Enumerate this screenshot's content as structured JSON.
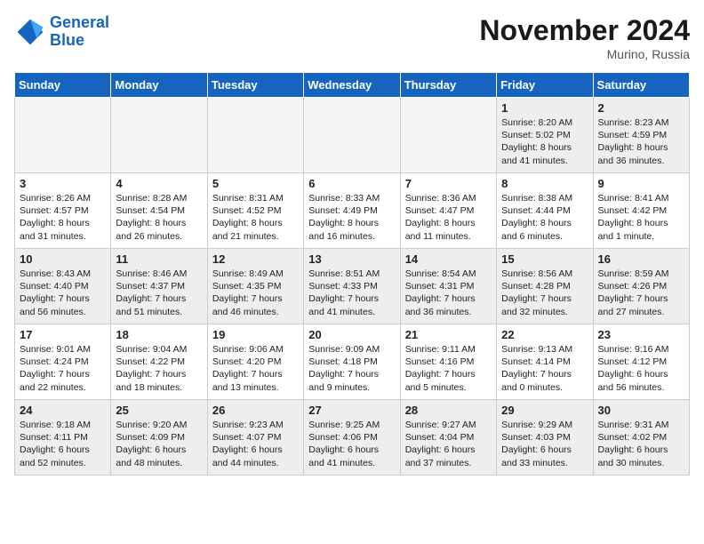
{
  "header": {
    "logo_line1": "General",
    "logo_line2": "Blue",
    "month": "November 2024",
    "location": "Murino, Russia"
  },
  "weekdays": [
    "Sunday",
    "Monday",
    "Tuesday",
    "Wednesday",
    "Thursday",
    "Friday",
    "Saturday"
  ],
  "weeks": [
    {
      "rowStyle": "gray",
      "days": [
        {
          "num": "",
          "text": ""
        },
        {
          "num": "",
          "text": ""
        },
        {
          "num": "",
          "text": ""
        },
        {
          "num": "",
          "text": ""
        },
        {
          "num": "",
          "text": ""
        },
        {
          "num": "1",
          "text": "Sunrise: 8:20 AM\nSunset: 5:02 PM\nDaylight: 8 hours\nand 41 minutes."
        },
        {
          "num": "2",
          "text": "Sunrise: 8:23 AM\nSunset: 4:59 PM\nDaylight: 8 hours\nand 36 minutes."
        }
      ]
    },
    {
      "rowStyle": "white",
      "days": [
        {
          "num": "3",
          "text": "Sunrise: 8:26 AM\nSunset: 4:57 PM\nDaylight: 8 hours\nand 31 minutes."
        },
        {
          "num": "4",
          "text": "Sunrise: 8:28 AM\nSunset: 4:54 PM\nDaylight: 8 hours\nand 26 minutes."
        },
        {
          "num": "5",
          "text": "Sunrise: 8:31 AM\nSunset: 4:52 PM\nDaylight: 8 hours\nand 21 minutes."
        },
        {
          "num": "6",
          "text": "Sunrise: 8:33 AM\nSunset: 4:49 PM\nDaylight: 8 hours\nand 16 minutes."
        },
        {
          "num": "7",
          "text": "Sunrise: 8:36 AM\nSunset: 4:47 PM\nDaylight: 8 hours\nand 11 minutes."
        },
        {
          "num": "8",
          "text": "Sunrise: 8:38 AM\nSunset: 4:44 PM\nDaylight: 8 hours\nand 6 minutes."
        },
        {
          "num": "9",
          "text": "Sunrise: 8:41 AM\nSunset: 4:42 PM\nDaylight: 8 hours\nand 1 minute."
        }
      ]
    },
    {
      "rowStyle": "gray",
      "days": [
        {
          "num": "10",
          "text": "Sunrise: 8:43 AM\nSunset: 4:40 PM\nDaylight: 7 hours\nand 56 minutes."
        },
        {
          "num": "11",
          "text": "Sunrise: 8:46 AM\nSunset: 4:37 PM\nDaylight: 7 hours\nand 51 minutes."
        },
        {
          "num": "12",
          "text": "Sunrise: 8:49 AM\nSunset: 4:35 PM\nDaylight: 7 hours\nand 46 minutes."
        },
        {
          "num": "13",
          "text": "Sunrise: 8:51 AM\nSunset: 4:33 PM\nDaylight: 7 hours\nand 41 minutes."
        },
        {
          "num": "14",
          "text": "Sunrise: 8:54 AM\nSunset: 4:31 PM\nDaylight: 7 hours\nand 36 minutes."
        },
        {
          "num": "15",
          "text": "Sunrise: 8:56 AM\nSunset: 4:28 PM\nDaylight: 7 hours\nand 32 minutes."
        },
        {
          "num": "16",
          "text": "Sunrise: 8:59 AM\nSunset: 4:26 PM\nDaylight: 7 hours\nand 27 minutes."
        }
      ]
    },
    {
      "rowStyle": "white",
      "days": [
        {
          "num": "17",
          "text": "Sunrise: 9:01 AM\nSunset: 4:24 PM\nDaylight: 7 hours\nand 22 minutes."
        },
        {
          "num": "18",
          "text": "Sunrise: 9:04 AM\nSunset: 4:22 PM\nDaylight: 7 hours\nand 18 minutes."
        },
        {
          "num": "19",
          "text": "Sunrise: 9:06 AM\nSunset: 4:20 PM\nDaylight: 7 hours\nand 13 minutes."
        },
        {
          "num": "20",
          "text": "Sunrise: 9:09 AM\nSunset: 4:18 PM\nDaylight: 7 hours\nand 9 minutes."
        },
        {
          "num": "21",
          "text": "Sunrise: 9:11 AM\nSunset: 4:16 PM\nDaylight: 7 hours\nand 5 minutes."
        },
        {
          "num": "22",
          "text": "Sunrise: 9:13 AM\nSunset: 4:14 PM\nDaylight: 7 hours\nand 0 minutes."
        },
        {
          "num": "23",
          "text": "Sunrise: 9:16 AM\nSunset: 4:12 PM\nDaylight: 6 hours\nand 56 minutes."
        }
      ]
    },
    {
      "rowStyle": "gray",
      "days": [
        {
          "num": "24",
          "text": "Sunrise: 9:18 AM\nSunset: 4:11 PM\nDaylight: 6 hours\nand 52 minutes."
        },
        {
          "num": "25",
          "text": "Sunrise: 9:20 AM\nSunset: 4:09 PM\nDaylight: 6 hours\nand 48 minutes."
        },
        {
          "num": "26",
          "text": "Sunrise: 9:23 AM\nSunset: 4:07 PM\nDaylight: 6 hours\nand 44 minutes."
        },
        {
          "num": "27",
          "text": "Sunrise: 9:25 AM\nSunset: 4:06 PM\nDaylight: 6 hours\nand 41 minutes."
        },
        {
          "num": "28",
          "text": "Sunrise: 9:27 AM\nSunset: 4:04 PM\nDaylight: 6 hours\nand 37 minutes."
        },
        {
          "num": "29",
          "text": "Sunrise: 9:29 AM\nSunset: 4:03 PM\nDaylight: 6 hours\nand 33 minutes."
        },
        {
          "num": "30",
          "text": "Sunrise: 9:31 AM\nSunset: 4:02 PM\nDaylight: 6 hours\nand 30 minutes."
        }
      ]
    }
  ]
}
